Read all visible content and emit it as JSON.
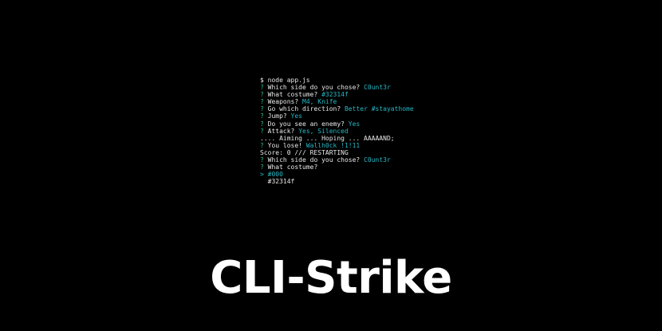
{
  "terminal": {
    "lines": [
      {
        "prefix": "$",
        "prefix_style": "plain",
        "text": " node app.js",
        "answer": ""
      },
      {
        "prefix": "?",
        "prefix_style": "q",
        "text": " Which side do you chose? ",
        "answer": "C0unt3r"
      },
      {
        "prefix": "?",
        "prefix_style": "q",
        "text": " What costume? ",
        "answer": "#32314f"
      },
      {
        "prefix": "?",
        "prefix_style": "q",
        "text": " Weapons? ",
        "answer": "M4, Knife"
      },
      {
        "prefix": "?",
        "prefix_style": "q",
        "text": " Go which direction? ",
        "answer": "Better #stayathome"
      },
      {
        "prefix": "?",
        "prefix_style": "q",
        "text": " Jump? ",
        "answer": "Yes"
      },
      {
        "prefix": "?",
        "prefix_style": "q",
        "text": " Do you see an enemy? ",
        "answer": "Yes"
      },
      {
        "prefix": "?",
        "prefix_style": "q",
        "text": " Attack? ",
        "answer": "Yes, Silenced"
      },
      {
        "prefix": "",
        "prefix_style": "plain",
        "text": ".... Aiming ... Hoping ... AAAAAND;",
        "answer": ""
      },
      {
        "prefix": "?",
        "prefix_style": "q",
        "text": " You lose! ",
        "answer": "Wallh0ck !1!11"
      },
      {
        "prefix": "",
        "prefix_style": "plain",
        "text": "Score: 0 /// RESTARTING",
        "answer": ""
      },
      {
        "prefix": "?",
        "prefix_style": "q",
        "text": " Which side do you chose? ",
        "answer": "C0unt3r"
      },
      {
        "prefix": "?",
        "prefix_style": "q",
        "text": " What costume?",
        "answer": ""
      },
      {
        "prefix": ">",
        "prefix_style": "cursor",
        "text": " ",
        "answer": "#000"
      },
      {
        "prefix": "",
        "prefix_style": "plain",
        "text": "  #32314f",
        "answer": ""
      }
    ]
  },
  "title": "CLI-Strike",
  "colors": {
    "background": "#000000",
    "question_mark": "#2ab87e",
    "answer": "#24b8c4",
    "text": "#e8e8e8",
    "title": "#ffffff"
  }
}
